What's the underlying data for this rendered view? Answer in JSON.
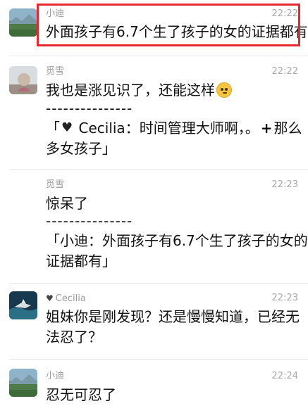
{
  "messages": [
    {
      "sender": "小迪",
      "time": "22:22",
      "lines": [
        "外面孩子有6.7个生了孩子的女的证据都有"
      ]
    },
    {
      "sender": "觅雪",
      "time": "22:22",
      "lines": [
        "我也是涨见识了，还能这样"
      ],
      "divider": "---------------",
      "quote_pre": "「",
      "quote_after_heart": " Cecilia：时间管理大师啊，。",
      "quote_after_plus": "那么",
      "quote_line2": "多女孩子」"
    },
    {
      "sender": "觅雪",
      "time": "22:23",
      "lines": [
        "惊呆了"
      ],
      "divider": "---------------",
      "quote_line1": "「小迪：外面孩子有6.7个生了孩子的女的",
      "quote_line2": "证据都有」"
    },
    {
      "sender": "Cecilia",
      "time": "22:23",
      "lines": [
        "姐妹你是刚发现？还是慢慢知道，已经无",
        "法忍了？"
      ]
    },
    {
      "sender": "小迪",
      "time": "22:24",
      "lines": [
        "忍无可忍了"
      ]
    }
  ],
  "icons": {
    "heart": "black-heart-icon",
    "plus": "plus-icon",
    "emoji": "grimacing-face-icon"
  },
  "colors": {
    "highlight_border": "#e3282f",
    "name_text": "#9b9b9b",
    "time_text": "#a8a8a8",
    "message_text": "#111111"
  }
}
